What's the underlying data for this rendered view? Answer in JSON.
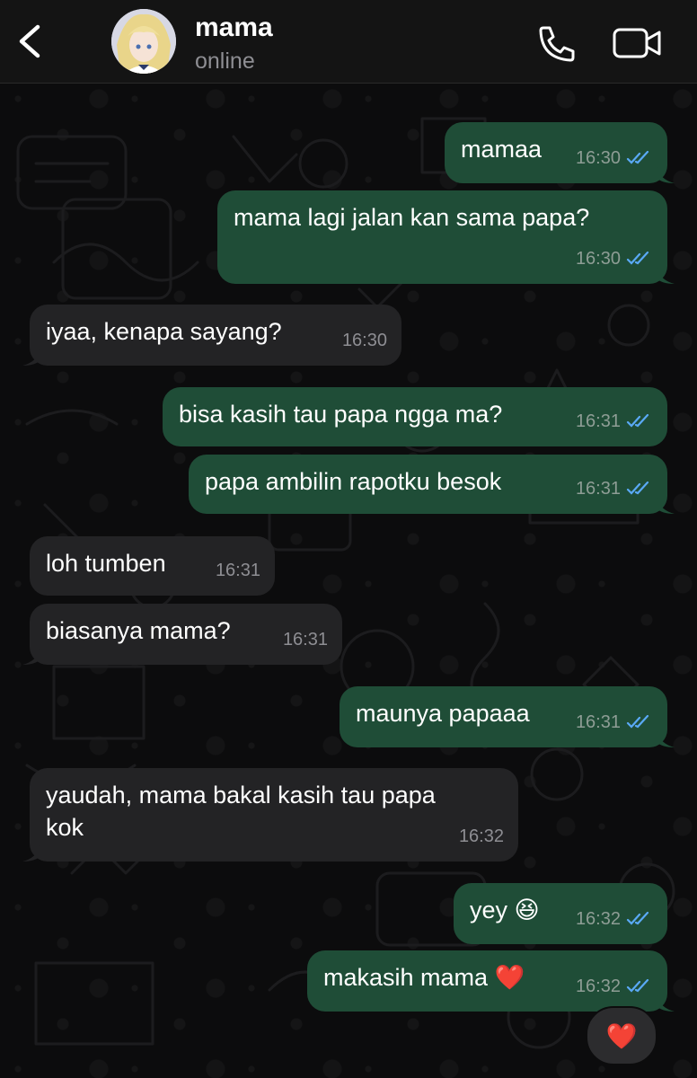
{
  "header": {
    "contact_name": "mama",
    "status": "online"
  },
  "messages": [
    {
      "text": "mamaa",
      "time": "16:30",
      "direction": "outgoing",
      "read": true
    },
    {
      "text": "mama lagi jalan kan sama papa?",
      "time": "16:30",
      "direction": "outgoing",
      "read": true
    },
    {
      "text": "iyaa, kenapa sayang?",
      "time": "16:30",
      "direction": "incoming"
    },
    {
      "text": "bisa kasih tau papa ngga ma?",
      "time": "16:31",
      "direction": "outgoing",
      "read": true
    },
    {
      "text": "papa ambilin rapotku besok",
      "time": "16:31",
      "direction": "outgoing",
      "read": true
    },
    {
      "text": "loh tumben",
      "time": "16:31",
      "direction": "incoming"
    },
    {
      "text": "biasanya mama?",
      "time": "16:31",
      "direction": "incoming"
    },
    {
      "text": "maunya papaaa",
      "time": "16:31",
      "direction": "outgoing",
      "read": true
    },
    {
      "text": "yaudah, mama bakal kasih tau papa\nkok",
      "time": "16:32",
      "direction": "incoming"
    },
    {
      "text": "yey 😆",
      "time": "16:32",
      "direction": "outgoing",
      "read": true
    },
    {
      "text": "makasih mama ❤️",
      "time": "16:32",
      "direction": "outgoing",
      "read": true
    }
  ],
  "reaction": {
    "emoji": "❤️"
  },
  "colors": {
    "outgoing_bubble": "#1f4d37",
    "incoming_bubble": "#232325",
    "read_tick": "#5aa9f5",
    "header_bg": "#141414"
  },
  "icons": [
    "back-chevron-icon",
    "phone-icon",
    "video-camera-icon",
    "double-check-icon"
  ]
}
